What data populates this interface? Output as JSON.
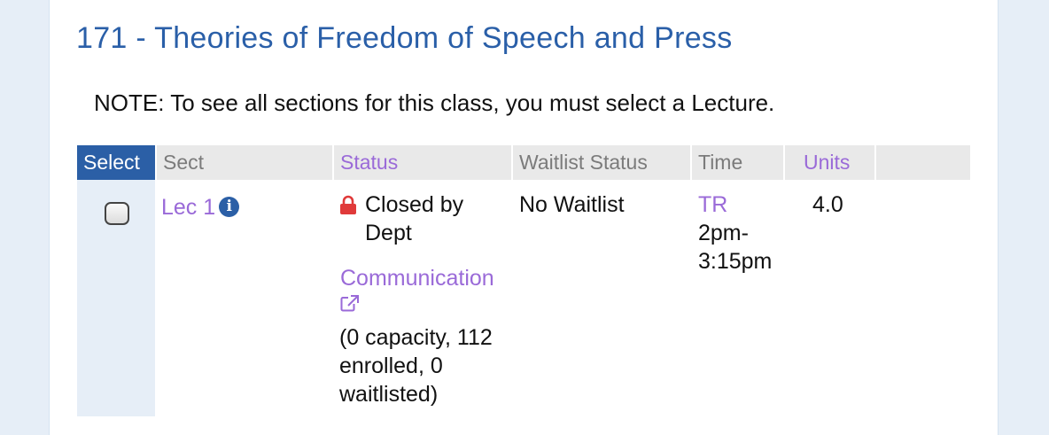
{
  "course": {
    "title": "171 - Theories of Freedom of Speech and Press",
    "note": "NOTE: To see all sections for this class, you must select a Lecture."
  },
  "table": {
    "headers": {
      "select": "Select",
      "sect": "Sect",
      "status": "Status",
      "waitlist": "Waitlist Status",
      "time": "Time",
      "units": "Units"
    },
    "row": {
      "sect": "Lec 1",
      "status_line1": "Closed by",
      "status_line2": "Dept",
      "dept_link": "Communication",
      "capacity_line1": "(0 capacity, 112",
      "capacity_line2": "enrolled, 0",
      "capacity_line3": "waitlisted)",
      "waitlist": "No Waitlist",
      "days": "TR",
      "time_line1": "2pm-",
      "time_line2": "3:15pm",
      "units": "4.0"
    }
  },
  "icons": {
    "info": "info-icon",
    "lock": "lock-icon",
    "external": "external-link-icon"
  },
  "colors": {
    "title": "#2a5fa8",
    "select_header_bg": "#2b5fa6",
    "link_purple": "#9a6ad8",
    "lock_red": "#e03a3a"
  }
}
